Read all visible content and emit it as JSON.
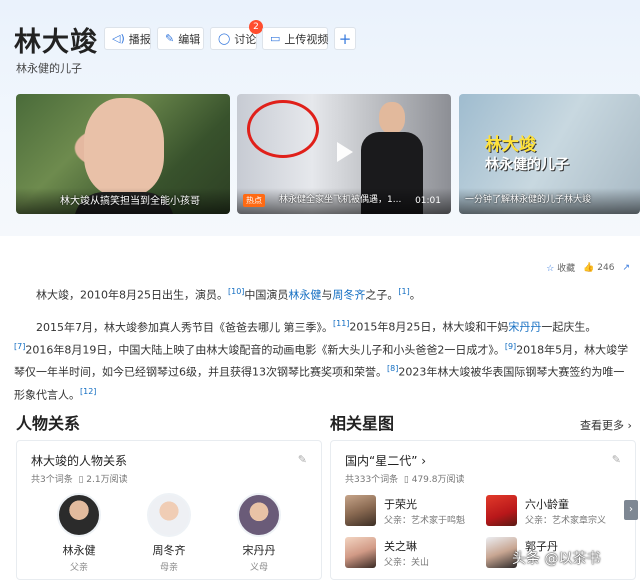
{
  "header": {
    "title": "林大竣",
    "subtitle": "林永健的儿子",
    "buttons": {
      "play": "播报",
      "edit": "编辑",
      "discuss": "讨论",
      "discuss_badge": "2",
      "upload": "上传视频",
      "more": "+"
    }
  },
  "videos": [
    {
      "title": "林大竣从搞笑担当到全能小孩哥"
    },
    {
      "hot_tag": "热点",
      "caption": "林永健全家坐飞机被偶遇，1...",
      "duration": "01:01"
    },
    {
      "name_overlay": "林大竣",
      "sub_overlay": "林永健的儿子",
      "caption": "一分钟了解林永健的儿子林大竣"
    }
  ],
  "actions": {
    "collect": "收藏",
    "like_count": "246"
  },
  "intro": {
    "p1_a": "林大竣，2010年8月25日出生，演员。",
    "ref_10": "[10]",
    "p1_b": "中国演员",
    "link_lyj": "林永健",
    "p1_c": "与",
    "link_zdq": "周冬齐",
    "p1_d": "之子。",
    "ref_1": "[1]",
    "p1_e": "。",
    "p2_a": "2015年7月，林大竣参加真人秀节目《爸爸去哪儿 第三季》。",
    "ref_11": "[11]",
    "p2_b": "2015年8月25日，林大竣和干妈",
    "link_sdd": "宋丹丹",
    "p2_c": "一起庆生。",
    "ref_7": "[7]",
    "p2_d": "2016年8月19日，中国大陆上映了由林大竣配音的动画电影《新大头儿子和小头爸爸2一日成才》。",
    "ref_9": "[9]",
    "p2_e": "2018年5月，林大竣学琴仅一年半时间，如今已经钢琴过6级，并且获得13次钢琴比赛奖项和荣誉。",
    "ref_8": "[8]",
    "p2_f": "2023年林大竣被华表国际钢琴大赛签约为唯一形象代言人。",
    "ref_12": "[12]"
  },
  "relations": {
    "heading": "人物关系",
    "panel_title": "林大竣的人物关系",
    "meta_entries": "共3个词条",
    "meta_views": "2.1万阅读",
    "people": [
      {
        "name": "林永健",
        "role": "父亲"
      },
      {
        "name": "周冬齐",
        "role": "母亲"
      },
      {
        "name": "宋丹丹",
        "role": "义母"
      }
    ]
  },
  "stars": {
    "heading": "相关星图",
    "see_more": "查看更多 ›",
    "panel_title": "国内“星二代” ›",
    "meta_entries": "共333个词条",
    "meta_views": "479.8万阅读",
    "items": [
      {
        "name": "于荣光",
        "desc": "父亲：艺术家于鸣魁"
      },
      {
        "name": "六小龄童",
        "desc": "父亲：艺术家章宗义"
      },
      {
        "name": "关之琳",
        "desc": "父亲：关山"
      },
      {
        "name": "郭子丹",
        "desc": ""
      }
    ]
  },
  "watermark": "头条 @以茶书",
  "colors": {
    "link": "#136ec2",
    "accent": "#3377dd",
    "badge": "#ff4d2e"
  }
}
